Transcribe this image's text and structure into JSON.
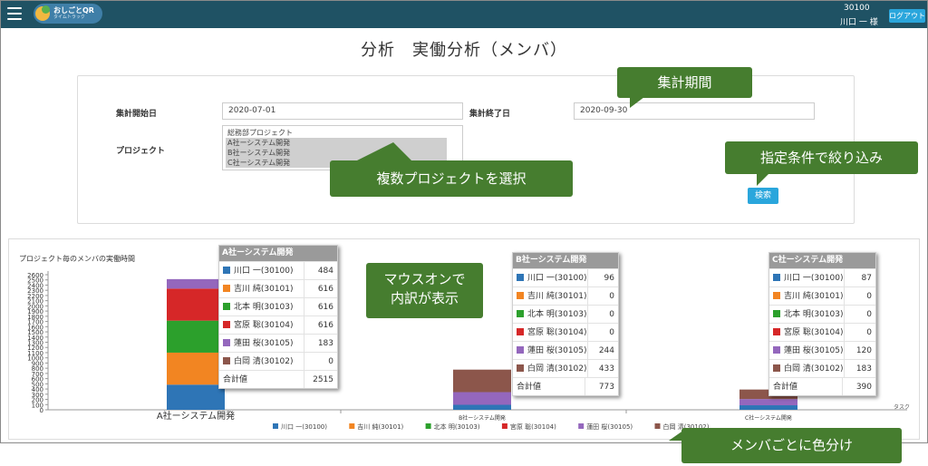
{
  "header": {
    "logo_title": "おしごとQR",
    "logo_sub": "タイムトラック",
    "user_id": "30100",
    "user_name": "川口 一 様",
    "logout_label": "ログアウト"
  },
  "page_title": "分析　実働分析（メンバ）",
  "form": {
    "start_label": "集計開始日",
    "start_value": "2020-07-01",
    "end_label": "集計終了日",
    "end_value": "2020-09-30",
    "project_label": "プロジェクト",
    "projects": [
      "総務部プロジェクト",
      "A社ーシステム開発",
      "B社ーシステム開発",
      "C社ーシステム開発"
    ],
    "search_label": "検索"
  },
  "callouts": {
    "period": "集計期間",
    "filter": "指定条件で絞り込み",
    "multi": "複数プロジェクトを選択",
    "hover": "マウスオンで\n内訳が表示",
    "color": "メンバごとに色分け"
  },
  "chart_data": {
    "type": "bar",
    "stacked": true,
    "title": "プロジェクト毎のメンバの実働時間",
    "xlabel": "タスク",
    "ylim": [
      0,
      2600
    ],
    "yticks": [
      0,
      100,
      200,
      300,
      400,
      500,
      600,
      700,
      800,
      900,
      1000,
      1100,
      1200,
      1300,
      1400,
      1500,
      1600,
      1700,
      1800,
      1900,
      2000,
      2100,
      2200,
      2300,
      2400,
      2500,
      2600
    ],
    "categories": [
      "A社ーシステム開発",
      "B社ーシステム開発",
      "C社ーシステム開発"
    ],
    "series": [
      {
        "name": "川口 一(30100)",
        "color": "#2e75b6",
        "values": [
          484,
          96,
          87
        ]
      },
      {
        "name": "吉川 純(30101)",
        "color": "#f28522",
        "values": [
          616,
          0,
          0
        ]
      },
      {
        "name": "北本 明(30103)",
        "color": "#2ca02c",
        "values": [
          616,
          0,
          0
        ]
      },
      {
        "name": "宮原 聡(30104)",
        "color": "#d62728",
        "values": [
          616,
          0,
          0
        ]
      },
      {
        "name": "蓮田 桜(30105)",
        "color": "#9467bd",
        "values": [
          183,
          244,
          120
        ]
      },
      {
        "name": "白岡 清(30102)",
        "color": "#8c564b",
        "values": [
          0,
          433,
          183
        ]
      }
    ],
    "totals": [
      2515,
      773,
      390
    ],
    "total_label": "合計値"
  }
}
